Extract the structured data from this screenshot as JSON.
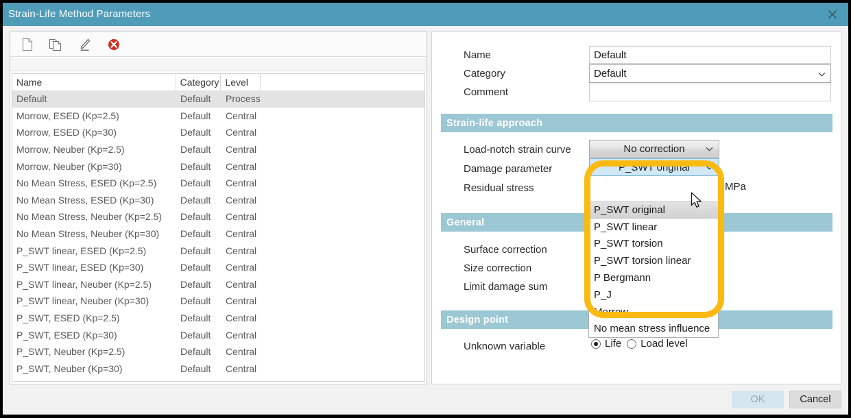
{
  "window": {
    "title": "Strain-Life Method Parameters",
    "close_icon": "close-icon"
  },
  "toolbar": {
    "icons": [
      {
        "name": "new-document-icon",
        "label": "New"
      },
      {
        "name": "copy-icon",
        "label": "Copy"
      },
      {
        "name": "edit-pencil-icon",
        "label": "Edit"
      },
      {
        "name": "delete-icon",
        "label": "Delete"
      }
    ]
  },
  "table": {
    "columns": [
      "Name",
      "Category",
      "Level",
      ""
    ],
    "selected_index": 0,
    "rows": [
      {
        "name": "Default",
        "category": "Default",
        "level": "Process"
      },
      {
        "name": "Morrow, ESED (Kp=2.5)",
        "category": "Default",
        "level": "Central"
      },
      {
        "name": "Morrow, ESED (Kp=30)",
        "category": "Default",
        "level": "Central"
      },
      {
        "name": "Morrow, Neuber (Kp=2.5)",
        "category": "Default",
        "level": "Central"
      },
      {
        "name": "Morrow, Neuber (Kp=30)",
        "category": "Default",
        "level": "Central"
      },
      {
        "name": "No Mean Stress, ESED (Kp=2.5)",
        "category": "Default",
        "level": "Central"
      },
      {
        "name": "No Mean Stress, ESED (Kp=30)",
        "category": "Default",
        "level": "Central"
      },
      {
        "name": "No Mean Stress, Neuber (Kp=2.5)",
        "category": "Default",
        "level": "Central"
      },
      {
        "name": "No Mean Stress, Neuber (Kp=30)",
        "category": "Default",
        "level": "Central"
      },
      {
        "name": "P_SWT linear, ESED (Kp=2.5)",
        "category": "Default",
        "level": "Central"
      },
      {
        "name": "P_SWT linear, ESED (Kp=30)",
        "category": "Default",
        "level": "Central"
      },
      {
        "name": "P_SWT linear, Neuber (Kp=2.5)",
        "category": "Default",
        "level": "Central"
      },
      {
        "name": "P_SWT linear, Neuber (Kp=30)",
        "category": "Default",
        "level": "Central"
      },
      {
        "name": "P_SWT, ESED (Kp=2.5)",
        "category": "Default",
        "level": "Central"
      },
      {
        "name": "P_SWT, ESED (Kp=30)",
        "category": "Default",
        "level": "Central"
      },
      {
        "name": "P_SWT, Neuber (Kp=2.5)",
        "category": "Default",
        "level": "Central"
      },
      {
        "name": "P_SWT, Neuber (Kp=30)",
        "category": "Default",
        "level": "Central"
      }
    ]
  },
  "form": {
    "name_label": "Name",
    "name_value": "Default",
    "category_label": "Category",
    "category_value": "Default",
    "comment_label": "Comment",
    "comment_value": ""
  },
  "strain_life_section": {
    "header": "Strain-life approach",
    "load_notch_label": "Load-notch strain curve",
    "load_notch_value": "No correction",
    "damage_parameter_label": "Damage parameter",
    "damage_parameter_value": "P_SWT original",
    "residual_stress_label": "Residual stress",
    "residual_stress_unit": "MPa"
  },
  "dropdown": {
    "open": true,
    "selected": "P_SWT original",
    "options": [
      "P_SWT original",
      "P_SWT linear",
      "P_SWT torsion",
      "P_SWT torsion linear",
      "P Bergmann",
      "P_J",
      "Morrow",
      "No mean stress influence"
    ]
  },
  "general_section": {
    "header": "General",
    "surface_correction_label": "Surface correction",
    "size_correction_label": "Size correction",
    "limit_damage_sum_label": "Limit damage sum"
  },
  "design_point_section": {
    "header": "Design point",
    "unknown_variable_label": "Unknown variable",
    "option_life": "Life",
    "option_load_level": "Load level",
    "selected": "Life"
  },
  "footer": {
    "ok_label": "OK",
    "cancel_label": "Cancel"
  },
  "colors": {
    "titlebar": "#4f9cb8",
    "section_header": "#9cc7d4",
    "highlight_ring": "#fbba12",
    "dropdown_open_bg": "#d2e7f5",
    "delete_icon": "#cc3322"
  }
}
